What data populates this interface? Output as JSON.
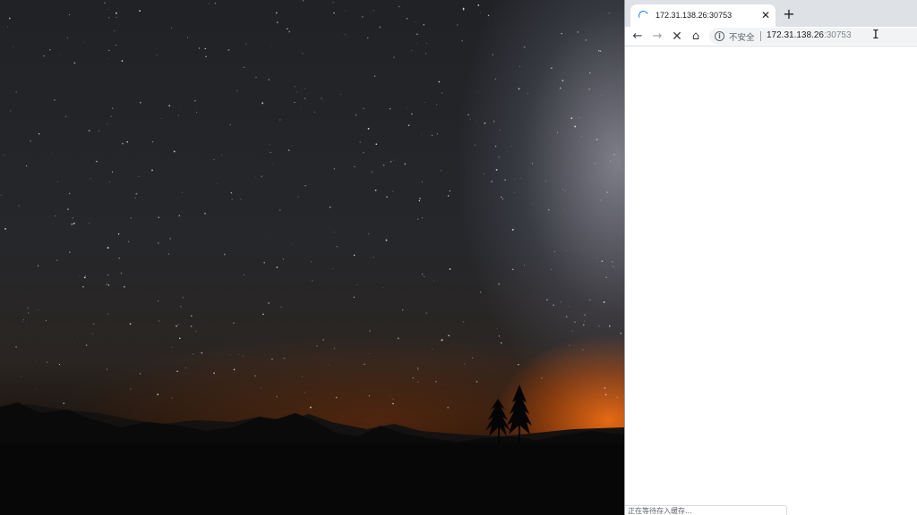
{
  "wallpaper": {
    "description_icon": "night-sky-milky-way-wallpaper"
  },
  "browser": {
    "tab": {
      "title": "172.31.138.26:30753",
      "loading_icon": "loading-spinner-icon",
      "close_label": "✕"
    },
    "new_tab_label": "+",
    "toolbar": {
      "back_label": "←",
      "forward_label": "→",
      "stop_label": "✕",
      "home_label": "⌂"
    },
    "omnibox": {
      "info_label": "i",
      "security_label": "不安全",
      "url_host": "172.31.138.26",
      "url_port": ":30753"
    },
    "status_text": "正在等待存入缓存..."
  },
  "colors": {
    "accent": "#1a73e8",
    "tabstrip": "#dee1e6",
    "omnibox": "#f1f3f4"
  }
}
